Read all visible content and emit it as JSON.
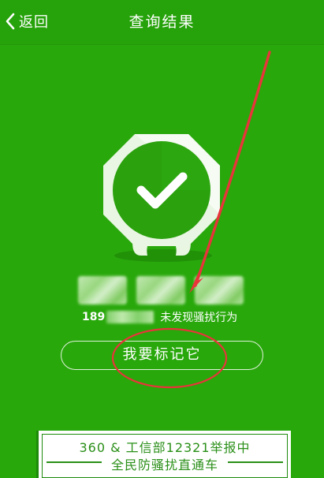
{
  "header": {
    "back_label": "返回",
    "title": "查询结果"
  },
  "result": {
    "number_prefix": "189",
    "status_text": "未发现骚扰行为"
  },
  "action": {
    "mark_label": "我要标记它"
  },
  "banner": {
    "line1": "360 & 工信部12321举报中",
    "line2": "全民防骚扰直通车"
  },
  "icons": {
    "back": "chevron-left-icon",
    "badge": "check-shield-icon"
  },
  "colors": {
    "background": "#29a80c",
    "header": "#26a20a",
    "annotation_red": "#e8343a"
  }
}
